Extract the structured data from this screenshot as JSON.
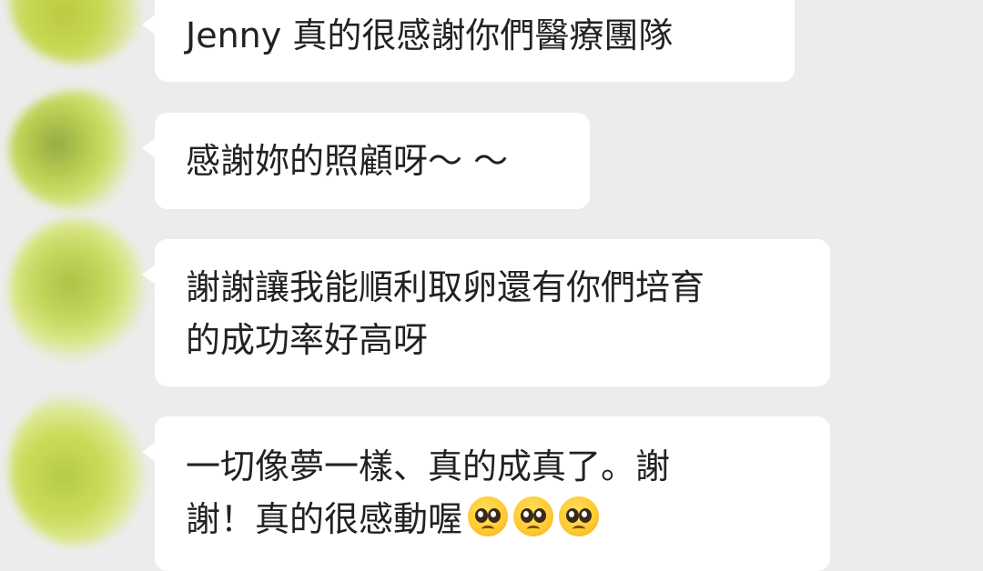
{
  "messages": [
    {
      "text": "Jenny 真的很感謝你們醫療團隊"
    },
    {
      "text": "感謝妳的照顧呀～ ～"
    },
    {
      "text": "謝謝讓我能順利取卵還有你們培育\n的成功率好高呀"
    },
    {
      "text": "一切像夢一樣、真的成真了。謝\n謝！真的很感動喔"
    }
  ],
  "emojis": [
    "pleading-face-icon",
    "pleading-face-icon",
    "pleading-face-icon"
  ],
  "colors": {
    "background": "#ececec",
    "bubble": "#ffffff",
    "text": "#222222"
  }
}
